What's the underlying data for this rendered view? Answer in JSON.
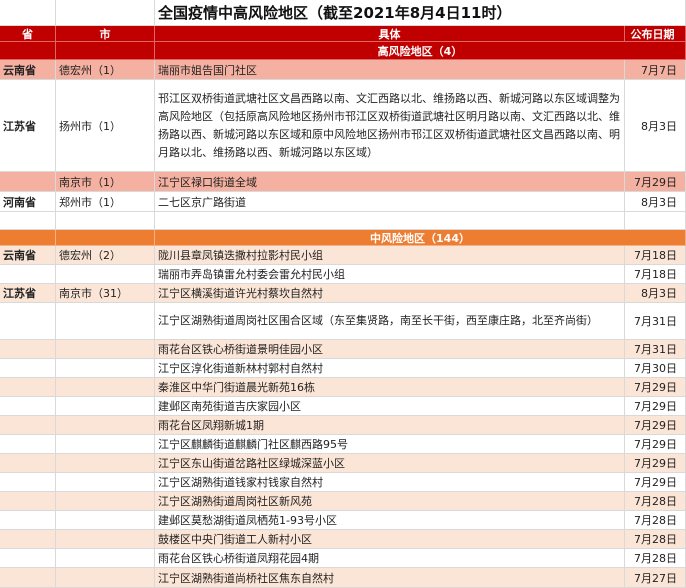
{
  "title": "全国疫情中高风险地区（截至2021年8月4日11时）",
  "headers": {
    "province": "省",
    "city": "市",
    "detail": "具体",
    "date": "公布日期"
  },
  "high": {
    "label": "高风险地区（4）",
    "rows": [
      {
        "province": "云南省",
        "city": "德宏州（1）",
        "detail": "瑞丽市姐告国门社区",
        "date": "7月7日"
      },
      {
        "province": "江苏省",
        "city": "扬州市（1）",
        "detail": "邗江区双桥街道武塘社区文昌西路以南、文汇西路以北、维扬路以西、新城河路以东区域调整为高风险地区（包括原高风险地区扬州市邗江区双桥街道武塘社区明月路以南、文汇西路以北、维扬路以西、新城河路以东区域和原中风险地区扬州市邗江区双桥街道武塘社区文昌西路以南、明月路以北、维扬路以西、新城河路以东区域）",
        "date": "8月3日"
      },
      {
        "province": "",
        "city": "南京市（1）",
        "detail": "江宁区禄口街道全域",
        "date": "7月29日"
      },
      {
        "province": "河南省",
        "city": "郑州市（1）",
        "detail": "二七区京广路街道",
        "date": "8月3日"
      }
    ]
  },
  "mid": {
    "label": "中风险地区（144）",
    "rows": [
      {
        "province": "云南省",
        "city": "德宏州（2）",
        "detail": "陇川县章凤镇迭撒村拉影村民小组",
        "date": "7月18日"
      },
      {
        "province": "",
        "city": "",
        "detail": "瑞丽市弄岛镇雷允村委会雷允村民小组",
        "date": "7月18日"
      },
      {
        "province": "江苏省",
        "city": "南京市（31）",
        "detail": "江宁区横溪街道许光村蔡坎自然村",
        "date": "8月3日"
      },
      {
        "province": "",
        "city": "",
        "detail": "江宁区湖熟街道周岗社区围合区域（东至集贤路，南至长干街，西至康庄路，北至齐尚街）",
        "date": "7月31日"
      },
      {
        "province": "",
        "city": "",
        "detail": "雨花台区铁心桥街道景明佳园小区",
        "date": "7月31日"
      },
      {
        "province": "",
        "city": "",
        "detail": "江宁区淳化街道新林村郭村自然村",
        "date": "7月30日"
      },
      {
        "province": "",
        "city": "",
        "detail": "秦淮区中华门街道晨光新苑16栋",
        "date": "7月29日"
      },
      {
        "province": "",
        "city": "",
        "detail": "建邺区南苑街道吉庆家园小区",
        "date": "7月29日"
      },
      {
        "province": "",
        "city": "",
        "detail": "雨花台区凤翔新城1期",
        "date": "7月29日"
      },
      {
        "province": "",
        "city": "",
        "detail": "江宁区麒麟街道麒麟门社区麒西路95号",
        "date": "7月29日"
      },
      {
        "province": "",
        "city": "",
        "detail": "江宁区东山街道岔路社区绿城深蓝小区",
        "date": "7月29日"
      },
      {
        "province": "",
        "city": "",
        "detail": "江宁区湖熟街道钱家村钱家自然村",
        "date": "7月29日"
      },
      {
        "province": "",
        "city": "",
        "detail": "江宁区湖熟街道周岗社区新风苑",
        "date": "7月28日"
      },
      {
        "province": "",
        "city": "",
        "detail": "建邺区莫愁湖街道凤栖苑1-93号小区",
        "date": "7月28日"
      },
      {
        "province": "",
        "city": "",
        "detail": "鼓楼区中央门街道工人新村小区",
        "date": "7月28日"
      },
      {
        "province": "",
        "city": "",
        "detail": "雨花台区铁心桥街道凤翔花园4期",
        "date": "7月28日"
      },
      {
        "province": "",
        "city": "",
        "detail": "江宁区湖熟街道尚桥社区焦东自然村",
        "date": "7月27日"
      }
    ]
  }
}
